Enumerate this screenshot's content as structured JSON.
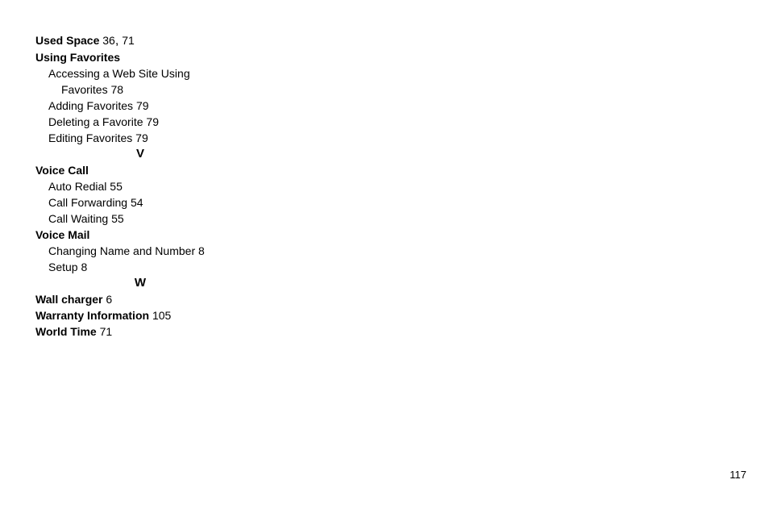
{
  "index": {
    "used_space": {
      "term": "Used Space",
      "pages_a": "36",
      "pages_b": "71"
    },
    "using_favorites": {
      "term": "Using Favorites",
      "sub": {
        "access_l1": "Accessing a Web Site Using",
        "access_l2": "Favorites",
        "access_pg": "78",
        "adding": "Adding Favorites",
        "adding_pg": "79",
        "deleting": "Deleting a Favorite",
        "deleting_pg": "79",
        "editing": "Editing Favorites",
        "editing_pg": "79"
      }
    },
    "section_v": "V",
    "voice_call": {
      "term": "Voice Call",
      "sub": {
        "auto_redial": "Auto Redial",
        "auto_redial_pg": "55",
        "call_fwd": "Call Forwarding",
        "call_fwd_pg": "54",
        "call_wait": "Call Waiting",
        "call_wait_pg": "55"
      }
    },
    "voice_mail": {
      "term": "Voice Mail",
      "sub": {
        "change": "Changing Name and Number",
        "change_pg": "8",
        "setup": "Setup",
        "setup_pg": "8"
      }
    },
    "section_w": "W",
    "wall_charger": {
      "term": "Wall charger",
      "pg": "6"
    },
    "warranty": {
      "term": "Warranty Information",
      "pg": "105"
    },
    "world_time": {
      "term": "World Time",
      "pg": "71"
    }
  },
  "page_number": "117"
}
